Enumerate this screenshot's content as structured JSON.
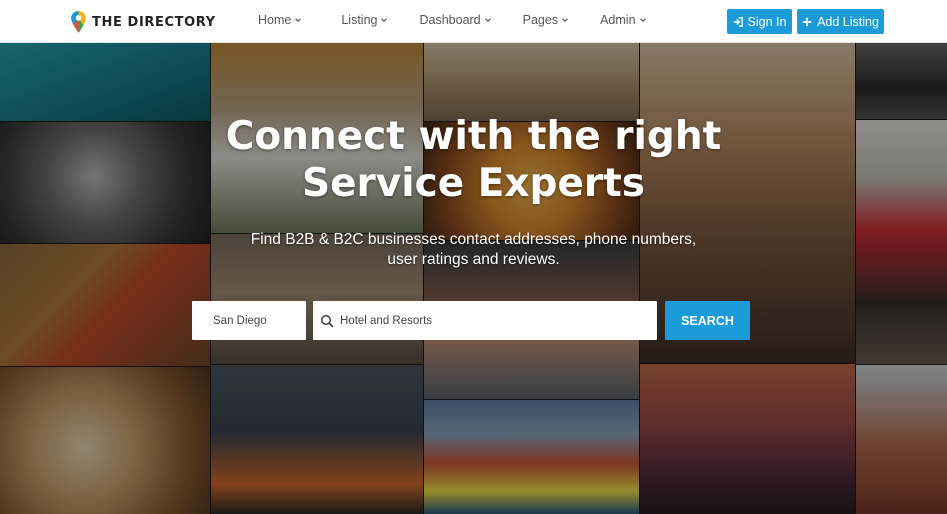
{
  "brand": {
    "name": "THE DIRECTORY",
    "icon": "map-pin-icon"
  },
  "nav": {
    "items": [
      {
        "label": "Home"
      },
      {
        "label": "Listing"
      },
      {
        "label": "Dashboard"
      },
      {
        "label": "Pages"
      },
      {
        "label": "Admin"
      }
    ],
    "signin_label": "Sign In",
    "add_listing_label": "Add Listing"
  },
  "hero": {
    "title_line1": "Connect with the right",
    "title_line2": "Service Experts",
    "subtitle_line1": "Find B2B & B2C businesses contact addresses, phone numbers,",
    "subtitle_line2": "user ratings and reviews."
  },
  "search": {
    "location_value": "San Diego",
    "keyword_value": "Hotel and Resorts",
    "button_label": "SEARCH"
  },
  "colors": {
    "accent": "#1b9cd8",
    "navbar_bg": "#ffffff",
    "brand_text": "#222222"
  }
}
